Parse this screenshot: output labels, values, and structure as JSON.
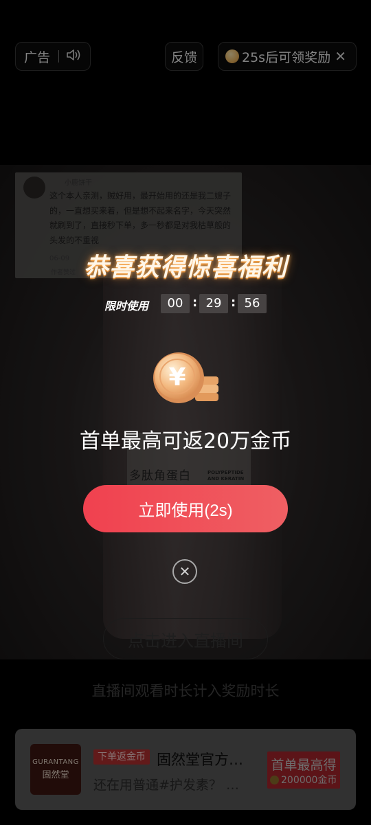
{
  "top_bar": {
    "ad_label": "广告",
    "feedback_label": "反馈",
    "reward_text": "25s后可领奖励",
    "close_glyph": "✕"
  },
  "background": {
    "comment": {
      "name": "小鹿饼干",
      "text": "这个本人亲测，贼好用，最开始用的还是我二嫂子的，一直想买来着，但是想不起来名字，今天突然就刷到了，直接秒下单，多一秒都是对我枯草般的头发的不重视",
      "meta": "06-09",
      "meta_reply": "回复",
      "meta2": "作者赞过"
    },
    "bottle_text": "多肽角蛋白",
    "bottle_en": [
      "POLYPEPTIDE",
      "AND KERATIN"
    ],
    "live_button": "点击进入直播间",
    "below_text": "直播间观看时长计入奖励时长"
  },
  "product": {
    "thumb_brand_en": "GURANTANG",
    "thumb_brand_cn": "固然堂",
    "tag": "下单返金币",
    "title": "固然堂官方…",
    "subtitle": "还在用普通#护发素？ …",
    "cta_line1": "首单最高得",
    "cta_line2": "200000金币"
  },
  "popup": {
    "title": "恭喜获得惊喜福利",
    "limit_label": "限时使用",
    "countdown": {
      "h": "00",
      "m": "29",
      "s": "56"
    },
    "description": "首单最高可返20万金币",
    "use_button": "立即使用(2s)",
    "close_glyph": "✕"
  },
  "colors": {
    "accent": "#ef4a56",
    "coin": "#f0b860"
  }
}
